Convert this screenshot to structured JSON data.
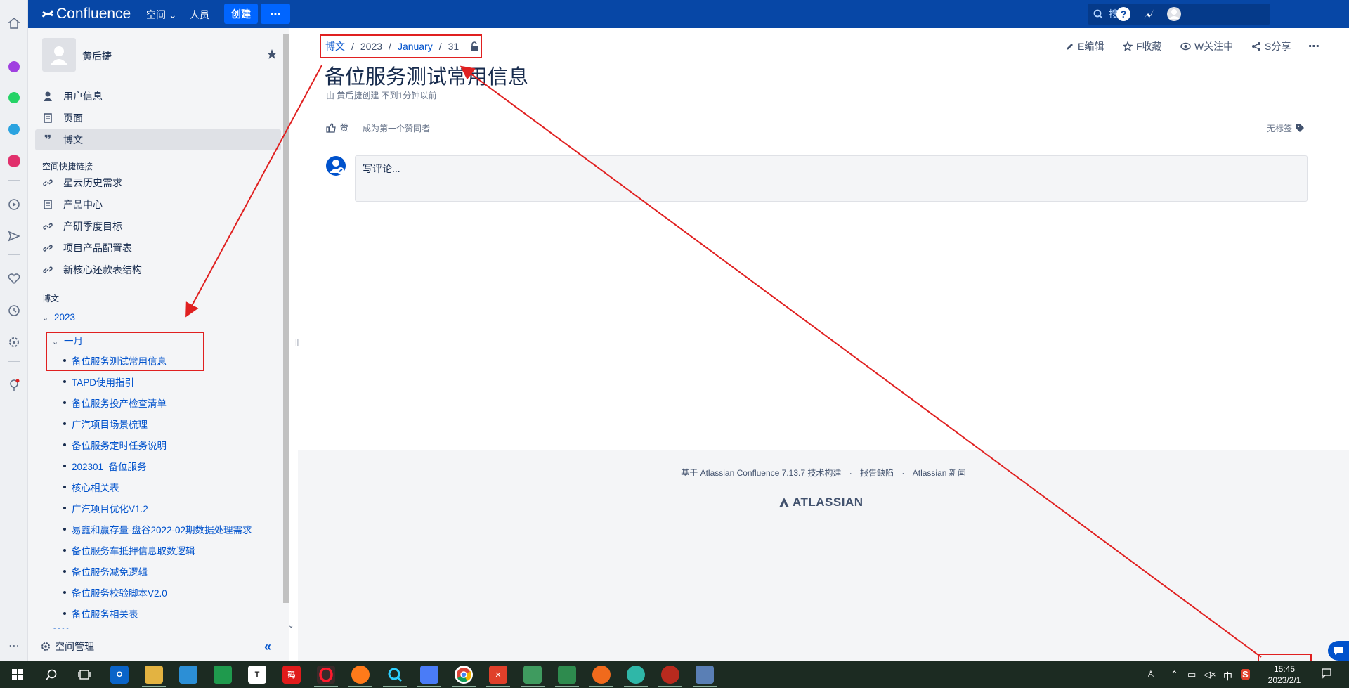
{
  "topnav": {
    "logo": "Confluence",
    "spaces": "空间",
    "people": "人员",
    "create": "创建",
    "search_placeholder": "搜索"
  },
  "sidebar": {
    "user_name": "黄后捷",
    "main_items": [
      {
        "label": "用户信息",
        "icon": "user-icon"
      },
      {
        "label": "页面",
        "icon": "page-icon"
      },
      {
        "label": "博文",
        "icon": "quote-icon"
      }
    ],
    "shortcuts_heading": "空间快捷链接",
    "shortcuts": [
      {
        "label": "星云历史需求",
        "icon": "link-icon"
      },
      {
        "label": "产品中心",
        "icon": "page-icon"
      },
      {
        "label": "产研季度目标",
        "icon": "link-icon"
      },
      {
        "label": "项目产品配置表",
        "icon": "link-icon"
      },
      {
        "label": "新核心还款表结构",
        "icon": "link-icon"
      }
    ],
    "blog_heading": "博文",
    "year": "2023",
    "month": "一月",
    "posts": [
      "备位服务测试常用信息",
      "TAPD使用指引",
      "备位服务投产检查清单",
      "广汽项目场景梳理",
      "备位服务定时任务说明",
      "202301_备位服务",
      "核心相关表",
      "广汽项目优化V1.2",
      "易鑫和赢存量-盘谷2022-02期数据处理需求",
      "备位服务车抵押信息取数逻辑",
      "备位服务减免逻辑",
      "备位服务校验脚本V2.0",
      "备位服务相关表"
    ],
    "more_dots": "- - - -",
    "space_admin": "空间管理"
  },
  "breadcrumb": [
    "博文",
    "2023",
    "January",
    "31"
  ],
  "actions": {
    "edit": "E编辑",
    "save": "F收藏",
    "watch": "W关注中",
    "share": "S分享"
  },
  "page": {
    "title": "备位服务测试常用信息",
    "byline": "由 黄后捷创建 不到1分钟以前",
    "like": "赞",
    "like_hint": "成为第一个赞同者",
    "labels": "无标签",
    "comment_placeholder": "写评论..."
  },
  "footer": {
    "powered": "基于 Atlassian Confluence 7.13.7 技术构建",
    "report": "报告缺陷",
    "news": "Atlassian 新闻",
    "logo": "ATLASSIAN"
  },
  "taskbar": {
    "time": "15:45",
    "date": "2023/2/1",
    "ime": "中"
  },
  "colors": {
    "nav_bg": "#0747a6",
    "link": "#0052cc",
    "annotation": "#e02020",
    "taskbar_bg": "#1c2b22"
  }
}
